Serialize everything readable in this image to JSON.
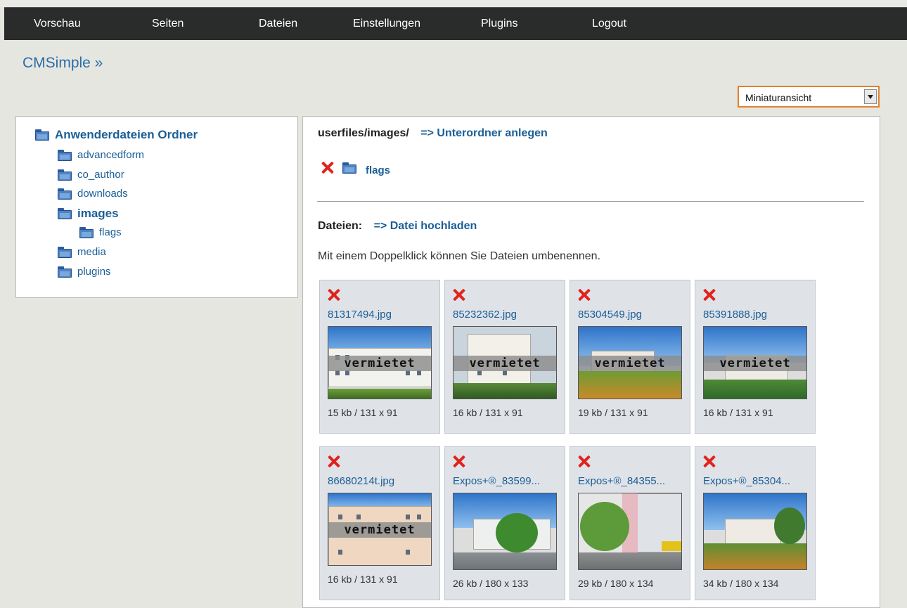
{
  "nav": {
    "items": [
      "Vorschau",
      "Seiten",
      "Dateien",
      "Einstellungen",
      "Plugins",
      "Logout"
    ]
  },
  "brand": "CMSimple »",
  "view_select": {
    "value": "Miniaturansicht"
  },
  "tree": {
    "root": "Anwenderdateien Ordner",
    "items": [
      {
        "label": "advancedform"
      },
      {
        "label": "co_author"
      },
      {
        "label": "downloads"
      },
      {
        "label": "images"
      },
      {
        "label": "flags"
      },
      {
        "label": "media"
      },
      {
        "label": "plugins"
      }
    ]
  },
  "main": {
    "path": "userfiles/images/",
    "create_subfolder": "=> Unterordner anlegen",
    "subfolder": "flags",
    "files_label": "Dateien:",
    "upload": "=> Datei hochladen",
    "info": "Mit einem Doppelklick können Sie Dateien umbenennen."
  },
  "files": [
    {
      "name": "81317494.jpg",
      "meta": "15 kb / 131 x 91",
      "overlay": "vermietet"
    },
    {
      "name": "85232362.jpg",
      "meta": "16 kb / 131 x 91",
      "overlay": "vermietet"
    },
    {
      "name": "85304549.jpg",
      "meta": "19 kb / 131 x 91",
      "overlay": "vermietet"
    },
    {
      "name": "85391888.jpg",
      "meta": "16 kb / 131 x 91",
      "overlay": "vermietet"
    },
    {
      "name": "86680214t.jpg",
      "meta": "16 kb / 131 x 91",
      "overlay": "vermietet"
    },
    {
      "name": "Expos+®_83599...",
      "meta": "26 kb / 180 x 133",
      "overlay": ""
    },
    {
      "name": "Expos+®_84355...",
      "meta": "29 kb / 180 x 134",
      "overlay": ""
    },
    {
      "name": "Expos+®_85304...",
      "meta": "34 kb / 180 x 134",
      "overlay": ""
    }
  ]
}
